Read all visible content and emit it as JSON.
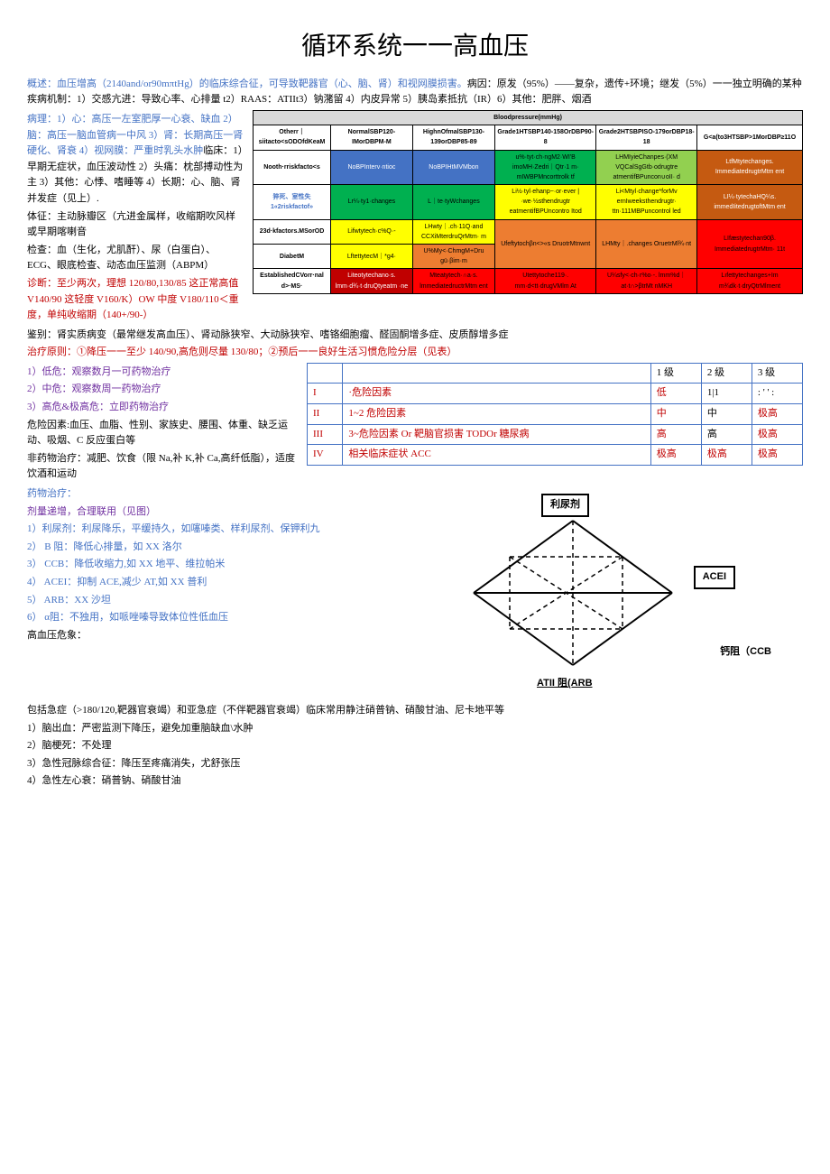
{
  "title": "循环系统一一高血压",
  "intro_p1a": "概述：血压增高（2140and/or90mπtHg）的临床综合征，可导致靶器官（心、脑、肾）和视网膜损害。",
  "intro_p1b": "病因：原发（95%）——复杂，遗传+环境；继发（5%）一一独立明确的某种疾病机制：1）交感亢进：导致心率、心排量 t2）RAAS：ATIIt3）钠潴留 4）内皮异常 5）胰岛素抵抗（IR）6）其他：肥胖、烟酒",
  "left": {
    "l1": "病理：1）心：高压一左室肥厚一心衰、缺血 2）脑：高压一脑血管病一中风 3）肾：长期高压一肾硬化、肾衰 4）视网膜：严重时乳头水肿",
    "l2": "临床：1）早期无症状，血压波动性 2）头痛：枕部搏动性为主 3）其他：心悸、嗜睡等 4）长期：心、脑、肾并发症（见上）.",
    "l3": "体征：主动脉瓣区（亢进金属样，收缩期吹风样或早期喀喇音",
    "l4": "检查：血（生化，尤肌酐）、尿（白蛋白）、ECG、眼底检查、动态血压监测（ABPM）",
    "l5": "诊断：至少两次，理想 120/80,130/85 这正常高值 V140/90 这轻度 V160/K）OW 中度 V180/110＜重度，单纯收缩期（140+/90-）"
  },
  "bptab": {
    "hdr": "Bloodpressure(mmHg)",
    "c0": "Otherr｜siitacto<sODOfdKeaM",
    "c1": "NormalSBP120-IMorDBPM-M",
    "c2": "HighnOfmalSBP130-139orDBP85-89",
    "c3": "Grade1HTSBP140-158OrDBP90-8",
    "c4": "Grade2HTSBPISO-179orDBP18-18",
    "c5": "G<a(to3HTSBP>1MorDBP≥11O",
    "r1": [
      "Nooth·rriskfacto<s",
      "NoBPInterv·ntioc",
      "NoBPIHtMVMbon",
      "u%·tyt·ch·ngM2·WI'B imoMH·Zedri｜Qtr·1 m· mIWBPMncorttrolk tf",
      "LHMIyieChanpes·(XM VQCalSgGtb·odrugtre atmentifBPuncon∪oII· d",
      "LtfMtytechanges. ImmediatedrugtrMtm ent"
    ],
    "r2": [
      "猝死、室性失 1«2riskfactof»",
      "Lr¼·ty1·changes",
      "L｜te·tyWchanges",
      "Li½·tyl·ehanp~·or·ever |·we·½sthendrugtr eatmentifBPUncontro Itod",
      "Li<Mtyl·change*forMv ernIweeksthendrugtr· ttn·111MBPuncontrol led",
      "LI¼·tytechaHQ¼s. immedIitedrugtoftMtm ent"
    ],
    "r3": [
      "23d·kfactors.MSorOD",
      "Lifwtytech·c%Q·-",
      "LHwty｜.ch·11Q·and CCXiMterdruQrMtm· m",
      "Ufeftytochβn<>«s DruotrMtnwnt",
      "LHMty｜.changes OruetrMl¾·nt",
      "LIfæstytechan90β. ImmediatedrugtrMtm· 11t"
    ],
    "r4": [
      "DiabetM",
      "LftettytecM｜*g4·",
      "U%My<·ChmgM+Dru gü·βim·m",
      "",
      ""
    ],
    "r5": [
      "EstablishedCVorr·nal d>·MS·",
      "Liteotytechano·s. lmm·d¾·t·druQtyeatm ·ne",
      "Mteatytech·∩a·s. lmmediatedructrMtm ent",
      "Utettytoche119·. mm·d<tt·drugVMlm At",
      "U¼sfy<·ch·r%o·-. lmm%d｜at·t∩>βtrMt nMKH",
      "Lıfettytechanges+Im m¾dk·t·dryQtrMlment"
    ]
  },
  "gap": "鉴别：肾实质病变（最常继发高血压）、肾动脉狭窄、大动脉狭窄、嗜铬细胞瘤、醛固酮增多症、皮质醇增多症",
  "tx_p": "治疗原则：①降压一一至少 140/90,高危则尽量 130/80；②预后一一良好生活习惯危险分层（见表）",
  "rows": {
    "a": "1）低危：观察数月一可药物治疗",
    "b": "2）中危：观察数周一药物治疗",
    "c": "3）高危&极高危：立即药物治疗"
  },
  "rf": "危险因素:血压、血脂、性别、家族史、腰围、体重、缺乏运动、吸烟、C 反应蛋白等",
  "nondrug": "非药物治疗：减肥、饮食（限 Na,补 K,补 Ca,高纤低脂），适度饮酒和运动",
  "drug": "药物治疗：",
  "dose": "剂量递增，合理联用（见图）",
  "d1": "1）利尿剂：利尿降乐，平缓持久，如噻嗪类、样利尿剂、保钾利九",
  "d2": "2）   B 阻：降低心排量，如 XX 洛尔",
  "d3": "3）   CCB：降低收缩力,如 XX 地平、维拉帕米",
  "d4": "4）   ACEI：抑制 ACE,减少 AT,如 XX 普利",
  "d5": "5）   ARB：XX 沙坦",
  "d6": "6）   α阻：不独用，如哌唑嗪导致体位性低血压",
  "crisis": "    高血压危象：",
  "crisis2": "包括急症（>180/120,靶器官衰竭）和亚急症（不伴靶器官衰竭）临床常用静注硝普钠、硝酸甘油、尼卡地平等",
  "e1": "1）脑出血：严密监测下降压，避免加重脑缺血\\水肿",
  "e2": "2）脑梗死：不处理",
  "e3": "3）急性冠脉综合征：降压至疼痛消失，尤舒张压",
  "e4": "4）急性左心衰：硝普钠、硝酸甘油",
  "risk": {
    "h1": "1 级",
    "h2": "2 级",
    "h3": "3 级",
    "r1": [
      "I",
      "·危险因素",
      "低",
      "1|1",
      ": '  ' :"
    ],
    "r2": [
      "II",
      "1~2 危险因素",
      "中",
      "中",
      "极高"
    ],
    "r3": [
      "III",
      "3~危险因素 Or 靶脑官损害 TODOr 糖尿病",
      "高",
      "高",
      "极高"
    ],
    "r4": [
      "IV",
      "相关临床症状 ACC",
      "极高",
      "极高",
      "极高"
    ]
  },
  "diag": {
    "top": "利尿剂",
    "right": "ACEI",
    "bottom": "ATII 阻(ARB",
    "rightb": "钙阻（CCB"
  }
}
